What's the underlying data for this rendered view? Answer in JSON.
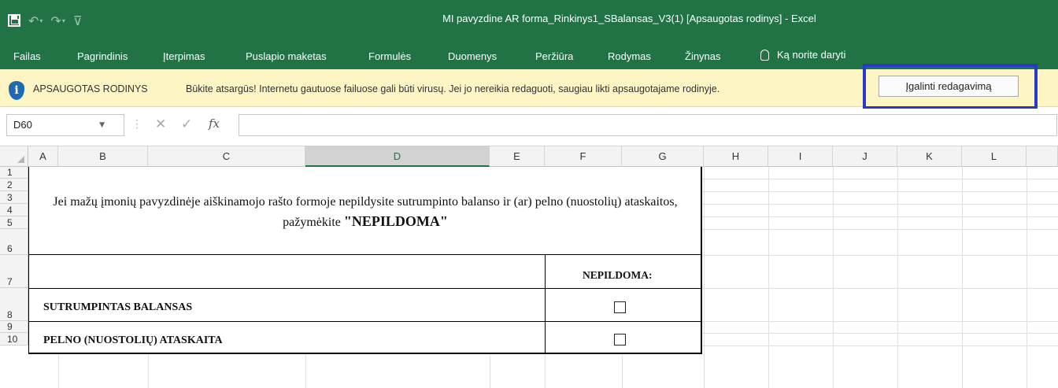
{
  "window": {
    "title": "MI pavyzdine AR forma_Rinkinys1_SBalansas_V3(1)  [Apsaugotas rodinys]  -  Excel",
    "qat": [
      "save-icon",
      "undo-icon",
      "redo-icon",
      "customize-icon"
    ]
  },
  "ribbon": {
    "tabs": [
      "Failas",
      "Pagrindinis",
      "Įterpimas",
      "Puslapio maketas",
      "Formulės",
      "Duomenys",
      "Peržiūra",
      "Rodymas",
      "Žinynas"
    ],
    "tell_me": "Ką norite daryti"
  },
  "protected_view": {
    "title": "APSAUGOTAS RODINYS",
    "message": "Būkite atsargūs! Internetu gautuose failuose gali būti virusų. Jei jo nereikia redaguoti, saugiau likti apsaugotajame rodinyje.",
    "enable_button": "Įgalinti redagavimą",
    "icon": "shield-info-icon",
    "highlight_color": "#2a39c9"
  },
  "formula_bar": {
    "name_box": "D60",
    "fx": "fx",
    "value": ""
  },
  "sheet": {
    "columns": [
      "A",
      "B",
      "C",
      "D",
      "E",
      "F",
      "G",
      "H",
      "I",
      "J",
      "K",
      "L"
    ],
    "selected_column": "D",
    "rows": [
      "1",
      "2",
      "3",
      "4",
      "5",
      "6",
      "7",
      "8",
      "9",
      "10"
    ],
    "intro_text": "Jei mažų įmonių pavyzdinėje aiškinamojo rašto formoje nepildysite sutrumpinto balanso ir (ar) pelno (nuostolių) ataskaitos, pažymėkite ",
    "intro_bold": "\"NEPILDOMA\"",
    "nepildoma_header": "NEPILDOMA:",
    "items": [
      {
        "label": "SUTRUMPINTAS BALANSAS",
        "checked": false
      },
      {
        "label": "PELNO (NUOSTOLIŲ) ATASKAITA",
        "checked": false
      }
    ]
  },
  "colors": {
    "excel_green": "#217346",
    "pv_bar": "#fdf5c4"
  }
}
